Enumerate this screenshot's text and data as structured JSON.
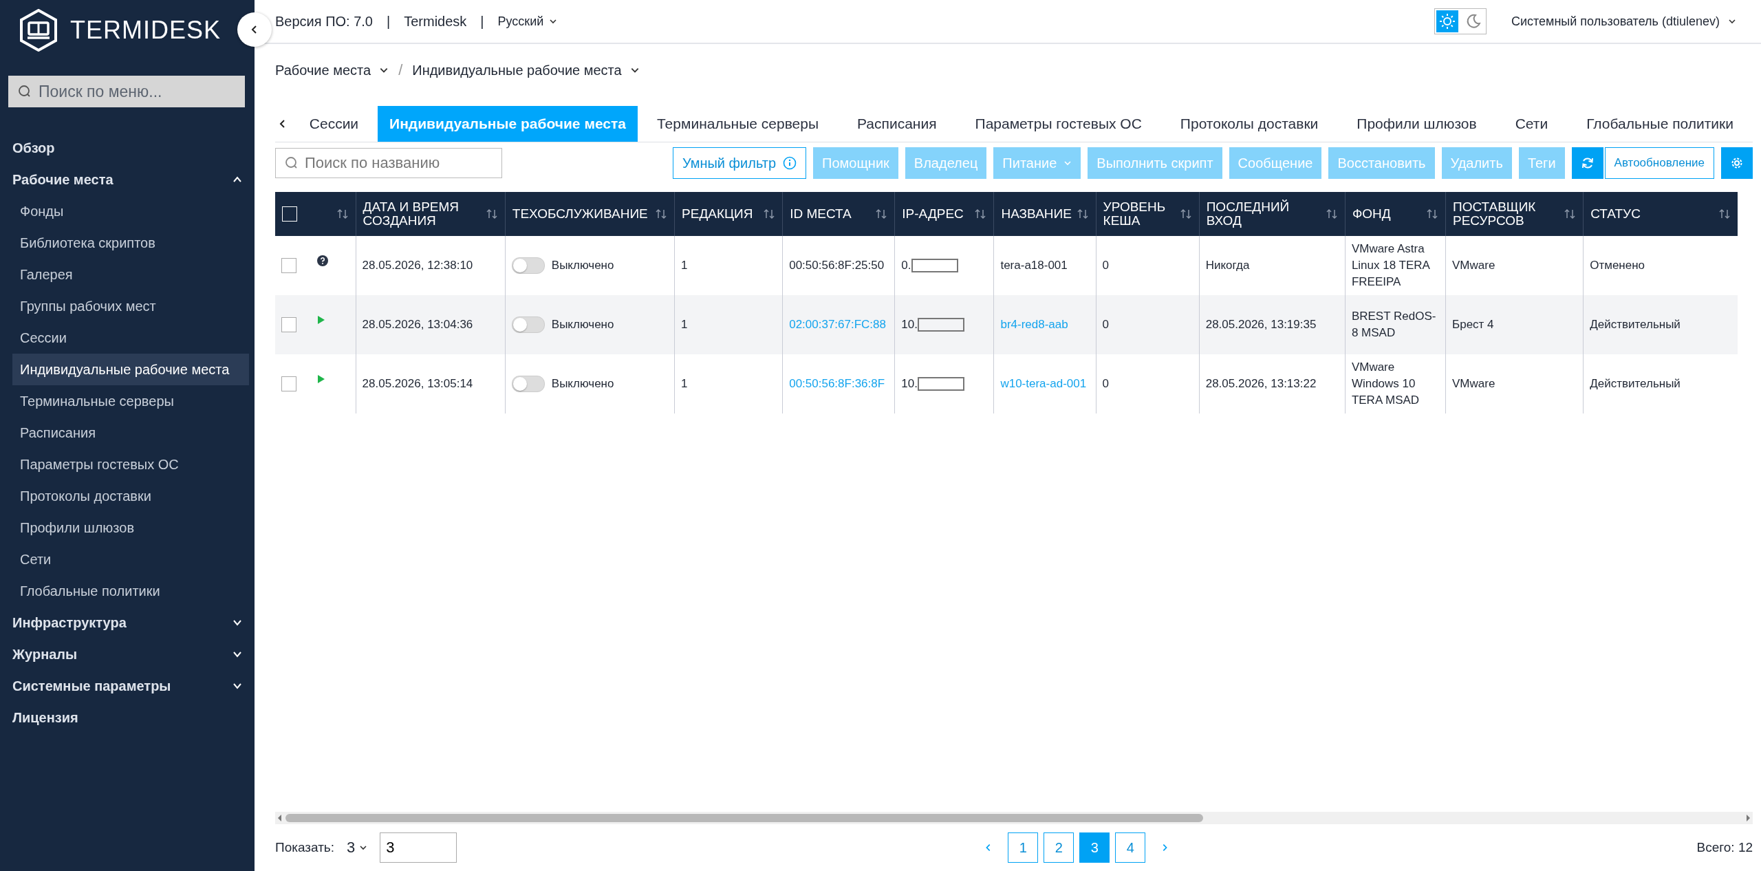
{
  "sidebar": {
    "logo": "TERMIDESK",
    "search": {
      "placeholder": "Поиск по меню..."
    },
    "items": [
      {
        "label": "Обзор",
        "selected": false
      },
      {
        "label": "Рабочие места",
        "selected": false,
        "expanded": true,
        "children": [
          {
            "label": "Фонды",
            "selected": false
          },
          {
            "label": "Библиотека скриптов",
            "selected": false
          },
          {
            "label": "Галерея",
            "selected": false
          },
          {
            "label": "Группы рабочих мест",
            "selected": false
          },
          {
            "label": "Сессии",
            "selected": false
          },
          {
            "label": "Индивидуальные рабочие места",
            "selected": true
          },
          {
            "label": "Терминальные серверы",
            "selected": false
          },
          {
            "label": "Расписания",
            "selected": false
          },
          {
            "label": "Параметры гостевых ОС",
            "selected": false
          },
          {
            "label": "Протоколы доставки",
            "selected": false
          },
          {
            "label": "Профили шлюзов",
            "selected": false
          },
          {
            "label": "Сети",
            "selected": false
          },
          {
            "label": "Глобальные политики",
            "selected": false
          }
        ]
      },
      {
        "label": "Инфраструктура",
        "selected": false,
        "expanded": false
      },
      {
        "label": "Журналы",
        "selected": false,
        "expanded": false
      },
      {
        "label": "Системные параметры",
        "selected": false,
        "expanded": false
      },
      {
        "label": "Лицензия",
        "selected": false
      }
    ]
  },
  "header": {
    "version": "Версия ПО: 7.0",
    "separator_1": "|",
    "product": "Termidesk",
    "separator_2": "|",
    "language": "Русский",
    "theme_buttons": [
      {
        "kind": "light",
        "selected": true
      },
      {
        "kind": "dark",
        "selected": false
      }
    ],
    "user": "Системный пользователь (dtiulenev)"
  },
  "breadcrumb": [
    {
      "label": "Рабочие места"
    },
    {
      "label": "Индивидуальные рабочие места"
    }
  ],
  "breadcrumb_separator": "/",
  "tabs": [
    {
      "label": "Сессии",
      "selected": false
    },
    {
      "label": "Индивидуальные рабочие места",
      "selected": true
    },
    {
      "label": "Терминальные серверы",
      "selected": false
    },
    {
      "label": "Расписания",
      "selected": false
    },
    {
      "label": "Параметры гостевых ОС",
      "selected": false
    },
    {
      "label": "Протоколы доставки",
      "selected": false
    },
    {
      "label": "Профили шлюзов",
      "selected": false
    },
    {
      "label": "Сети",
      "selected": false
    },
    {
      "label": "Глобальные политики",
      "selected": false
    }
  ],
  "toolbar": {
    "search": {
      "placeholder": "Поиск по названию"
    },
    "buttons": [
      {
        "kind": "filter",
        "label": "Умный фильтр",
        "disabled": false
      },
      {
        "kind": "action",
        "label": "Помощник",
        "disabled": true
      },
      {
        "kind": "action",
        "label": "Владелец",
        "disabled": true
      },
      {
        "kind": "menu",
        "label": "Питание",
        "disabled": true
      },
      {
        "kind": "action",
        "label": "Выполнить скрипт",
        "disabled": true
      },
      {
        "kind": "action",
        "label": "Сообщение",
        "disabled": true
      },
      {
        "kind": "action",
        "label": "Восстановить",
        "disabled": true
      },
      {
        "kind": "action",
        "label": "Удалить",
        "disabled": true
      },
      {
        "kind": "action",
        "label": "Теги",
        "disabled": true
      },
      {
        "kind": "refresh",
        "disabled": false
      },
      {
        "kind": "toggle",
        "label": "Автообновление",
        "disabled": false
      },
      {
        "kind": "settings",
        "disabled": false
      }
    ]
  },
  "table": {
    "select_all": {
      "checked": false
    },
    "columns": [
      "ДАТА И ВРЕМЯ СОЗДАНИЯ",
      "ТЕХОБСЛУЖИВАНИЕ",
      "РЕДАКЦИЯ",
      "ID МЕСТА",
      "IP-АДРЕС",
      "НАЗВАНИЕ",
      "УРОВЕНЬ КЕША",
      "ПОСЛЕДНИЙ ВХОД",
      "ФОНД",
      "ПОСТАВЩИК РЕСУРСОВ",
      "СТАТУС"
    ],
    "rows": [
      {
        "checked": false,
        "kind": "unknown",
        "link": false,
        "created": "28.05.2026, 12:38:10",
        "maintenance": {
          "on": false,
          "label": "Выключено"
        },
        "edition": "1",
        "id": "00:50:56:8F:25:50",
        "ip": "0.",
        "name": "tera-a18-001",
        "cache": "0",
        "last_login": "Никогда",
        "fund": "VMware Astra Linux 18 TERA FREEIPA",
        "provider": "VMware",
        "status": "Отменено"
      },
      {
        "checked": false,
        "kind": "running",
        "link": true,
        "created": "28.05.2026, 13:04:36",
        "maintenance": {
          "on": false,
          "label": "Выключено"
        },
        "edition": "1",
        "id": "02:00:37:67:FC:88",
        "ip": "10.",
        "name": "br4-red8-aab",
        "cache": "0",
        "last_login": "28.05.2026, 13:19:35",
        "fund": "BREST RedOS-8 MSAD",
        "provider": "Брест 4",
        "status": "Действительный"
      },
      {
        "checked": false,
        "kind": "running",
        "link": true,
        "created": "28.05.2026, 13:05:14",
        "maintenance": {
          "on": false,
          "label": "Выключено"
        },
        "edition": "1",
        "id": "00:50:56:8F:36:8F",
        "ip": "10.",
        "name": "w10-tera-ad-001",
        "cache": "0",
        "last_login": "28.05.2026, 13:13:22",
        "fund": "VMware Windows 10 TERA MSAD",
        "provider": "VMware",
        "status": "Действительный"
      }
    ]
  },
  "pagination": {
    "show_label": "Показать:",
    "page_size": "3",
    "page_input": "3",
    "pages": [
      {
        "label": "1",
        "selected": false
      },
      {
        "label": "2",
        "selected": false
      },
      {
        "label": "3",
        "selected": true
      },
      {
        "label": "4",
        "selected": false
      }
    ],
    "total": "Всего: 12"
  }
}
